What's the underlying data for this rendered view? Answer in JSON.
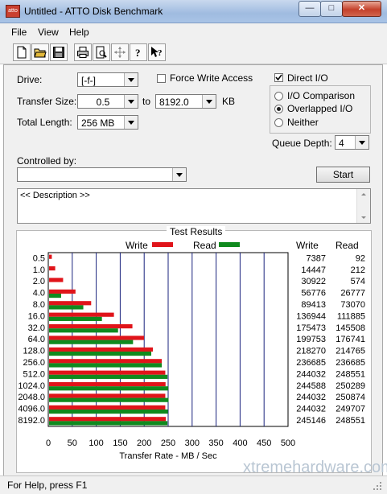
{
  "window": {
    "title": "Untitled - ATTO Disk Benchmark",
    "icon_text": "atto",
    "buttons": [
      "minimize",
      "maximize",
      "close"
    ]
  },
  "menu": [
    "File",
    "View",
    "Help"
  ],
  "toolbar_icons": [
    "new-icon",
    "open-icon",
    "save-icon",
    "print-icon",
    "print-preview-icon",
    "move-icon",
    "help-icon",
    "context-help-icon"
  ],
  "settings": {
    "drive_label": "Drive:",
    "drive_value": "[-f-]",
    "transfer_size_label": "Transfer Size:",
    "transfer_from": "0.5",
    "to_label": "to",
    "transfer_to": "8192.0",
    "kb_label": "KB",
    "total_length_label": "Total Length:",
    "total_length_value": "256 MB",
    "force_write_label": "Force Write Access",
    "force_write_checked": false,
    "direct_io_label": "Direct I/O",
    "direct_io_checked": true,
    "io_options": [
      "I/O Comparison",
      "Overlapped I/O",
      "Neither"
    ],
    "io_selected": "Overlapped I/O",
    "queue_depth_label": "Queue Depth:",
    "queue_depth_value": "4",
    "controlled_by_label": "Controlled by:",
    "controlled_by_value": "",
    "start_label": "Start",
    "description": "<< Description >>"
  },
  "results": {
    "title": "Test Results",
    "write_legend": "Write",
    "read_legend": "Read",
    "write_col": "Write",
    "read_col": "Read",
    "write_color": "#e0141a",
    "read_color": "#0f8a1e",
    "xlabel": "Transfer Rate - MB / Sec"
  },
  "chart_data": {
    "type": "bar",
    "orientation": "horizontal",
    "title": "Test Results",
    "xlabel": "Transfer Rate - MB / Sec",
    "xlim": [
      0,
      500
    ],
    "xticks": [
      "0",
      "50",
      "100",
      "150",
      "200",
      "250",
      "300",
      "350",
      "400",
      "450",
      "500"
    ],
    "categories": [
      "0.5",
      "1.0",
      "2.0",
      "4.0",
      "8.0",
      "16.0",
      "32.0",
      "64.0",
      "128.0",
      "256.0",
      "512.0",
      "1024.0",
      "2048.0",
      "4096.0",
      "8192.0"
    ],
    "series": [
      {
        "name": "Write",
        "values": [
          7387,
          14447,
          30922,
          56776,
          89413,
          136944,
          175473,
          199753,
          218270,
          236685,
          244032,
          244588,
          244032,
          244032,
          245146
        ]
      },
      {
        "name": "Read",
        "values": [
          92,
          212,
          574,
          26777,
          73070,
          111885,
          145508,
          176741,
          214765,
          236685,
          248551,
          250289,
          250874,
          249707,
          248551
        ]
      }
    ],
    "write_display": [
      "7387",
      "14447",
      "30922",
      "56776",
      "89413",
      "136944",
      "175473",
      "199753",
      "218270",
      "236685",
      "244032",
      "244588",
      "244032",
      "244032",
      "245146"
    ],
    "read_display": [
      "92",
      "212",
      "574",
      "26777",
      "73070",
      "111885",
      "145508",
      "176741",
      "214765",
      "236685",
      "248551",
      "250289",
      "250874",
      "249707",
      "248551"
    ]
  },
  "watermark": "xtremehardware.com",
  "status": "For Help, press F1"
}
